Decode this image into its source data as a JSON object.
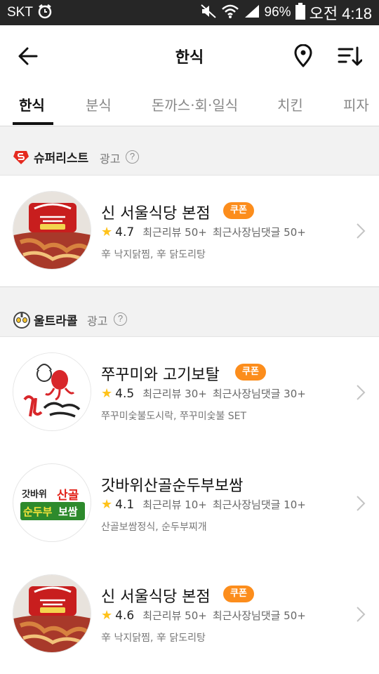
{
  "status_bar": {
    "carrier": "SKT",
    "battery": "96%",
    "time": "오전 4:18"
  },
  "header": {
    "title": "한식",
    "back_icon": "arrow-left-icon",
    "location_icon": "map-pin-icon",
    "sort_icon": "sort-lines-icon"
  },
  "tabs": [
    {
      "label": "한식",
      "active": true
    },
    {
      "label": "분식",
      "active": false
    },
    {
      "label": "돈까스·회·일식",
      "active": false
    },
    {
      "label": "치킨",
      "active": false
    },
    {
      "label": "피자",
      "active": false
    }
  ],
  "sections": [
    {
      "brand": "슈퍼리스트",
      "ad_label": "광고",
      "help": "?",
      "restaurants": [
        {
          "name": "신 서울식당 본점",
          "coupon": "쿠폰",
          "rating": "4.7",
          "reviews": "최근리뷰 50+",
          "owner_replies": "최근사장님댓글 50+",
          "menu": "辛 낙지닭찜, 辛 닭도리탕"
        }
      ]
    },
    {
      "brand": "울트라콜",
      "ad_label": "광고",
      "help": "?",
      "restaurants": [
        {
          "name": "쭈꾸미와 고기보탈",
          "coupon": "쿠폰",
          "rating": "4.5",
          "reviews": "최근리뷰 30+",
          "owner_replies": "최근사장님댓글 30+",
          "menu": "쭈꾸미숯불도시락, 쭈꾸미숯불 SET"
        },
        {
          "name": "갓바위산골순두부보쌈",
          "coupon": "",
          "rating": "4.1",
          "reviews": "최근리뷰 10+",
          "owner_replies": "최근사장님댓글 10+",
          "menu": "산골보쌈정식, 순두부찌개"
        },
        {
          "name": "신 서울식당 본점",
          "coupon": "쿠폰",
          "rating": "4.6",
          "reviews": "최근리뷰 50+",
          "owner_replies": "최근사장님댓글 50+",
          "menu": "辛 낙지닭찜, 辛 닭도리탕"
        }
      ]
    }
  ],
  "logos": {
    "seoul": {
      "text": "신서울식당"
    },
    "jjukkumi": {
      "text": "쭈꾸미와 고기보탈"
    },
    "gatbawi": {
      "line1a": "갓바위",
      "line1b": "산골",
      "line2a": "순두부",
      "line2b": "보쌈"
    }
  },
  "colors": {
    "coupon": "#fc8d1c",
    "star": "#ffc21a",
    "section_bg": "#f2f2f2",
    "status_bg": "#262626"
  }
}
